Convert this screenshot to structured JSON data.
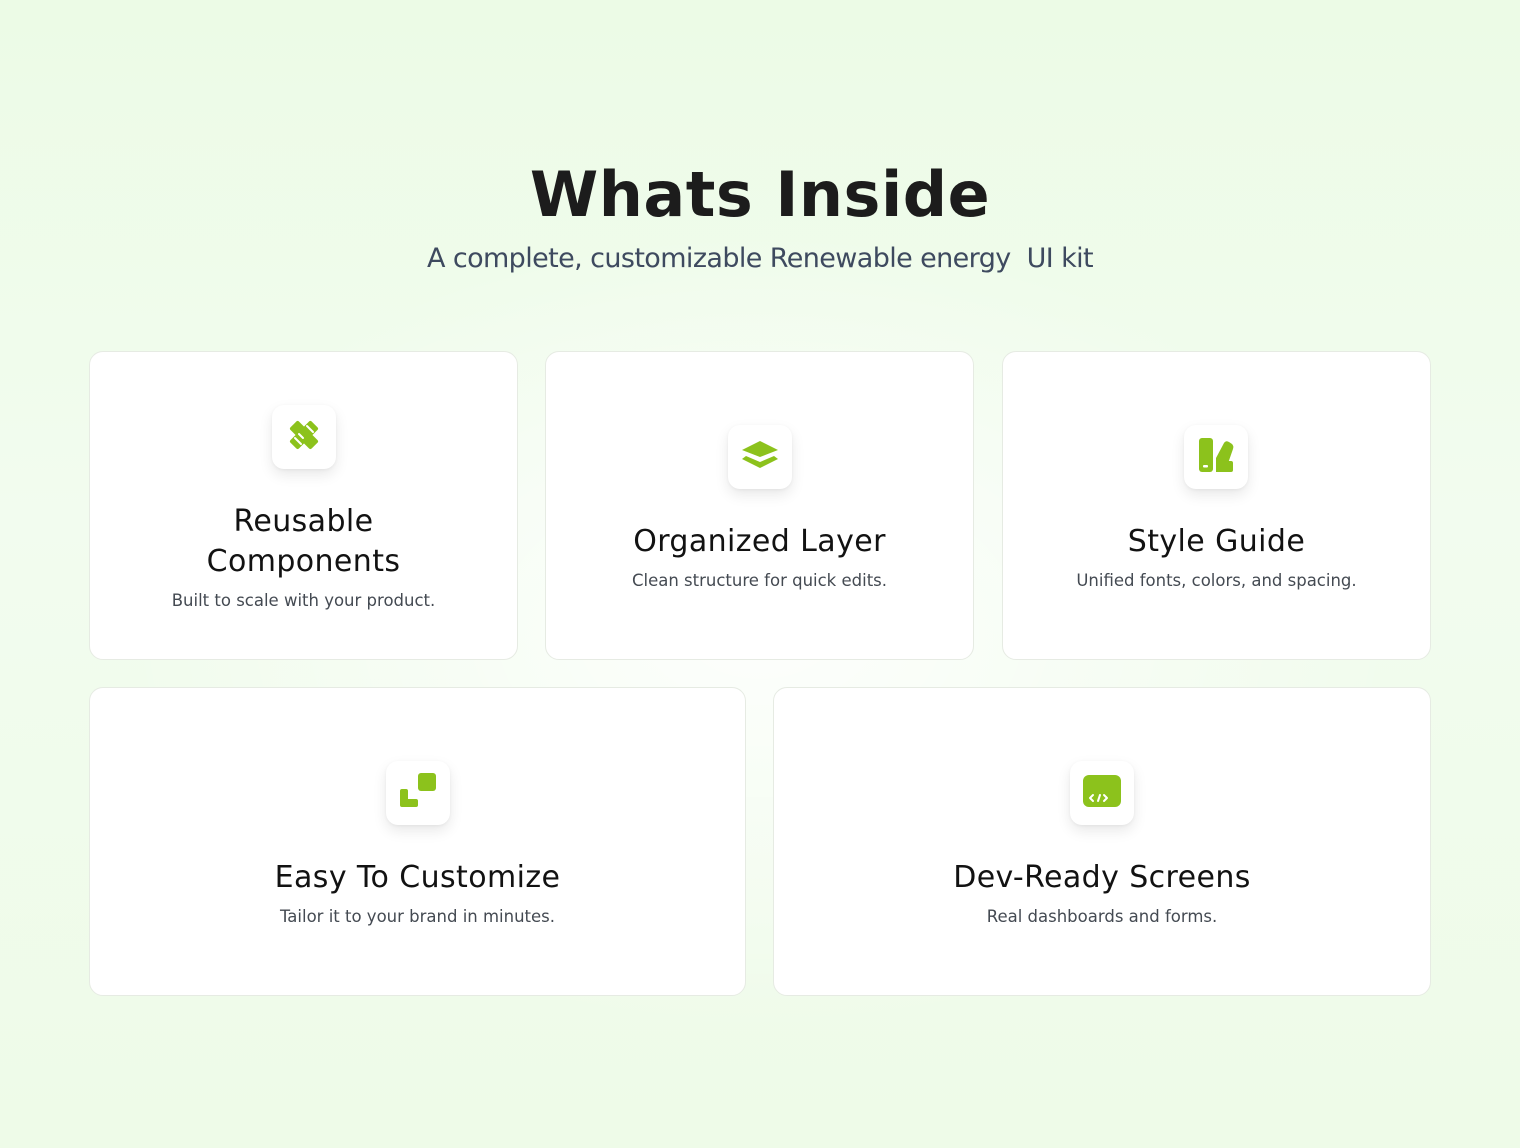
{
  "header": {
    "title": "Whats Inside",
    "subtitle": "A complete, customizable Renewable energy  UI kit"
  },
  "accent_color": "#8cc21c",
  "cards": [
    {
      "icon": "pencil-ruler-icon",
      "title": "Reusable Components",
      "description": "Built to scale with your product."
    },
    {
      "icon": "layers-icon",
      "title": "Organized Layer",
      "description": "Clean structure for quick edits."
    },
    {
      "icon": "color-swatch-icon",
      "title": "Style Guide",
      "description": "Unified fonts, colors, and spacing."
    },
    {
      "icon": "resize-icon",
      "title": "Easy To Customize",
      "description": "Tailor it to your brand in minutes."
    },
    {
      "icon": "code-screen-icon",
      "title": "Dev-Ready Screens",
      "description": "Real dashboards and forms."
    }
  ]
}
